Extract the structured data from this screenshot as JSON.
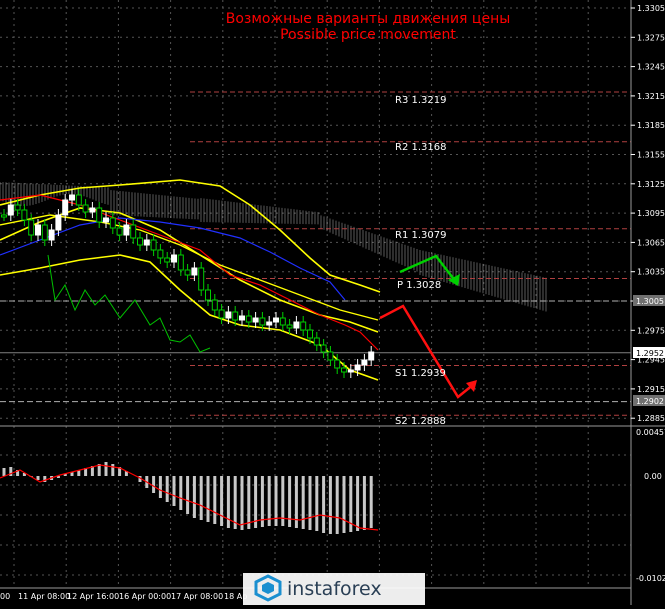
{
  "title": {
    "ru": "Возможные варианты движения цены",
    "en": "Possible price movement",
    "color": "#ff0000"
  },
  "price_axis": {
    "ticks": [
      "1.3305",
      "1.3275",
      "1.3245",
      "1.3215",
      "1.3185",
      "1.3155",
      "1.3125",
      "1.3095",
      "1.3065",
      "1.3035",
      "1.3005",
      "1.2975",
      "1.2945",
      "1.2915",
      "1.2885"
    ],
    "current_price": "1.2952",
    "level_1005": "1.3005",
    "level_2902": "1.2902"
  },
  "levels": [
    {
      "label": "R3",
      "value": "1.3219"
    },
    {
      "label": "R2",
      "value": "1.3168"
    },
    {
      "label": "R1",
      "value": "1.3079"
    },
    {
      "label": "P",
      "value": "1.3028"
    },
    {
      "label": "S1",
      "value": "1.2939"
    },
    {
      "label": "S2",
      "value": "1.2888"
    }
  ],
  "time_axis": {
    "labels": [
      "00",
      "11 Apr 08:00",
      "12 Apr 16:00",
      "16 Apr 00:00",
      "17 Apr 08:00",
      "18 Ap"
    ]
  },
  "oscillator_axis": {
    "ticks": [
      "0.00457",
      "0.00",
      "-0.01027"
    ]
  },
  "watermark": {
    "brand": "instaforex"
  },
  "colors": {
    "background": "#000000",
    "grid": "#555555",
    "bollinger": "#ffff00",
    "ma_red": "#ff0000",
    "ma_blue": "#2030ff",
    "chikou_green": "#00c000",
    "bull_arrow": "#00d000",
    "bear_arrow": "#ff1010",
    "histogram": "#c8c8c8"
  }
}
